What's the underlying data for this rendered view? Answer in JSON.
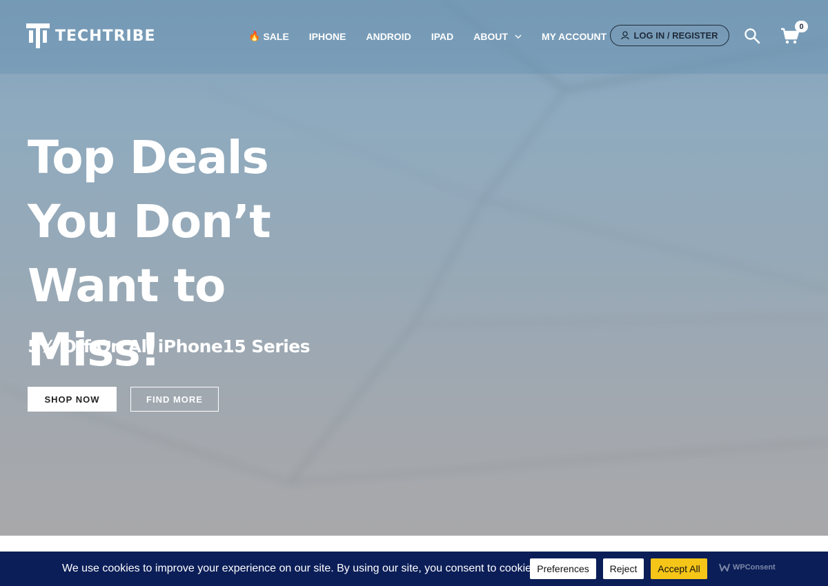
{
  "header": {
    "logo_text": "TECHTRIBE",
    "nav": [
      {
        "label": "SALE",
        "icon": "fire-icon"
      },
      {
        "label": "IPHONE"
      },
      {
        "label": "ANDROID"
      },
      {
        "label": "IPAD"
      },
      {
        "label": "ABOUT",
        "dropdown": true
      },
      {
        "label": "MY ACCOUNT"
      }
    ],
    "login_label": "LOG IN / REGISTER",
    "cart_count": "0"
  },
  "hero": {
    "title": "Top Deals You Don’t Want to Miss!",
    "subtitle": "5% Off On All iPhone15 Series",
    "shop_label": "SHOP NOW",
    "find_label": "FIND MORE"
  },
  "cookie": {
    "text": "We use cookies to improve your experience on our site. By using our site, you consent to cookies.",
    "preferences": "Preferences",
    "reject": "Reject",
    "accept": "Accept All",
    "brand": "WPConsent",
    "accept_color": "#f5c518",
    "bar_color": "#0b1e58"
  }
}
